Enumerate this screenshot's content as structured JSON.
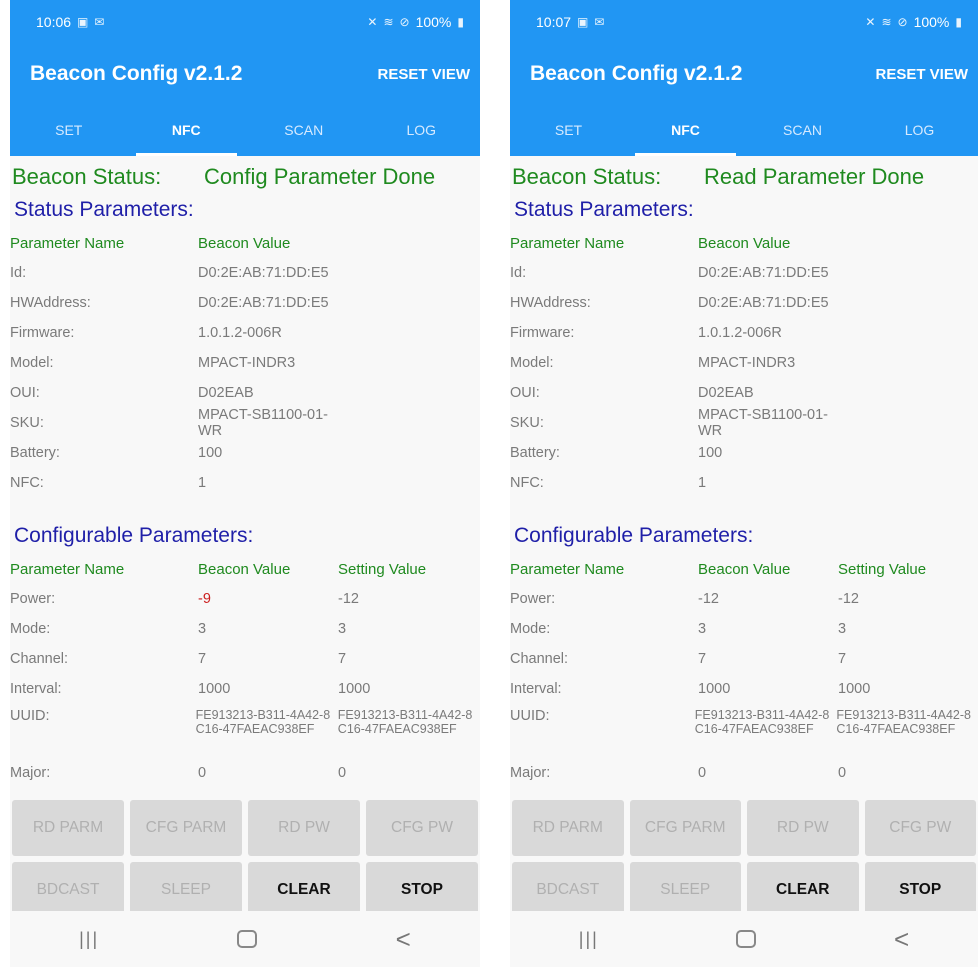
{
  "phones": [
    {
      "status_bar": {
        "time": "10:06",
        "battery": "100%"
      },
      "app": {
        "title": "Beacon Config v2.1.2",
        "reset_label": "RESET VIEW"
      },
      "tabs": [
        {
          "label": "SET"
        },
        {
          "label": "NFC"
        },
        {
          "label": "SCAN"
        },
        {
          "label": "LOG"
        }
      ],
      "beacon_status": {
        "label": "Beacon Status:",
        "value": "Config Parameter Done"
      },
      "status_section": {
        "title": "Status Parameters:",
        "header": {
          "name": "Parameter Name",
          "value": "Beacon Value"
        },
        "rows": [
          {
            "name": "Id:",
            "value": "D0:2E:AB:71:DD:E5"
          },
          {
            "name": "HWAddress:",
            "value": "D0:2E:AB:71:DD:E5"
          },
          {
            "name": "Firmware:",
            "value": "1.0.1.2-006R"
          },
          {
            "name": "Model:",
            "value": "MPACT-INDR3"
          },
          {
            "name": "OUI:",
            "value": "D02EAB"
          },
          {
            "name": "SKU:",
            "value": "MPACT-SB1100-01-WR"
          },
          {
            "name": "Battery:",
            "value": "100"
          },
          {
            "name": "NFC:",
            "value": "1"
          }
        ]
      },
      "config_section": {
        "title": "Configurable Parameters:",
        "header": {
          "name": "Parameter Name",
          "beacon": "Beacon Value",
          "setting": "Setting Value"
        },
        "rows": [
          {
            "name": "Power:",
            "beacon": "-9",
            "setting": "-12"
          },
          {
            "name": "Mode:",
            "beacon": "3",
            "setting": "3"
          },
          {
            "name": "Channel:",
            "beacon": "7",
            "setting": "7"
          },
          {
            "name": "Interval:",
            "beacon": "1000",
            "setting": "1000"
          },
          {
            "name": "UUID:",
            "beacon": "FE913213-B311-4A42-8C16-47FAEAC938EF",
            "setting": "FE913213-B311-4A42-8C16-47FAEAC938EF"
          },
          {
            "name": "Major:",
            "beacon": "0",
            "setting": "0"
          }
        ]
      },
      "buttons": [
        "RD PARM",
        "CFG PARM",
        "RD PW",
        "CFG PW",
        "BDCAST",
        "SLEEP",
        "CLEAR",
        "STOP"
      ],
      "nav": {
        "recents": "|||",
        "back": "<"
      }
    },
    {
      "status_bar": {
        "time": "10:07",
        "battery": "100%"
      },
      "app": {
        "title": "Beacon Config v2.1.2",
        "reset_label": "RESET VIEW"
      },
      "tabs": [
        {
          "label": "SET"
        },
        {
          "label": "NFC"
        },
        {
          "label": "SCAN"
        },
        {
          "label": "LOG"
        }
      ],
      "beacon_status": {
        "label": "Beacon Status:",
        "value": "Read Parameter Done"
      },
      "status_section": {
        "title": "Status Parameters:",
        "header": {
          "name": "Parameter Name",
          "value": "Beacon Value"
        },
        "rows": [
          {
            "name": "Id:",
            "value": "D0:2E:AB:71:DD:E5"
          },
          {
            "name": "HWAddress:",
            "value": "D0:2E:AB:71:DD:E5"
          },
          {
            "name": "Firmware:",
            "value": "1.0.1.2-006R"
          },
          {
            "name": "Model:",
            "value": "MPACT-INDR3"
          },
          {
            "name": "OUI:",
            "value": "D02EAB"
          },
          {
            "name": "SKU:",
            "value": "MPACT-SB1100-01-WR"
          },
          {
            "name": "Battery:",
            "value": "100"
          },
          {
            "name": "NFC:",
            "value": "1"
          }
        ]
      },
      "config_section": {
        "title": "Configurable Parameters:",
        "header": {
          "name": "Parameter Name",
          "beacon": "Beacon Value",
          "setting": "Setting Value"
        },
        "rows": [
          {
            "name": "Power:",
            "beacon": "-12",
            "setting": "-12"
          },
          {
            "name": "Mode:",
            "beacon": "3",
            "setting": "3"
          },
          {
            "name": "Channel:",
            "beacon": "7",
            "setting": "7"
          },
          {
            "name": "Interval:",
            "beacon": "1000",
            "setting": "1000"
          },
          {
            "name": "UUID:",
            "beacon": "FE913213-B311-4A42-8C16-47FAEAC938EF",
            "setting": "FE913213-B311-4A42-8C16-47FAEAC938EF"
          },
          {
            "name": "Major:",
            "beacon": "0",
            "setting": "0"
          }
        ]
      },
      "buttons": [
        "RD PARM",
        "CFG PARM",
        "RD PW",
        "CFG PW",
        "BDCAST",
        "SLEEP",
        "CLEAR",
        "STOP"
      ],
      "nav": {
        "recents": "|||",
        "back": "<"
      }
    }
  ],
  "icons": {
    "status_left": [
      "image-icon",
      "mail-icon"
    ],
    "status_right": [
      "mute-icon",
      "wifi-icon",
      "dnd-icon",
      "battery-icon"
    ]
  },
  "colors": {
    "primary": "#2196f3",
    "status_green": "#1f8a1f",
    "section_blue": "#1f1fa8",
    "highlight_red": "#cc1f1f"
  }
}
